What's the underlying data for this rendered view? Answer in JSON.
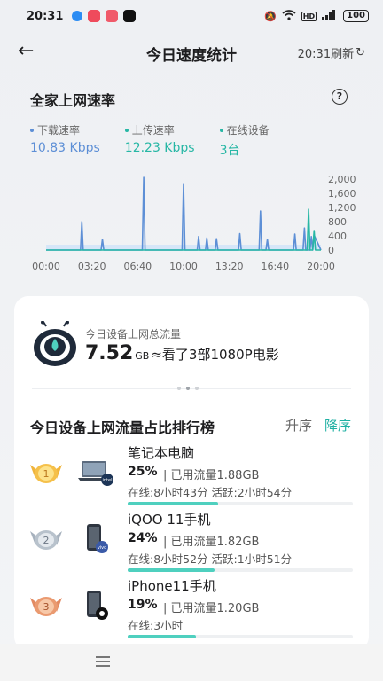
{
  "status_bar": {
    "time": "20:31",
    "battery": "100"
  },
  "nav": {
    "back": "←",
    "title": "今日速度统计",
    "refresh_label": "20:31刷新",
    "refresh_icon": "↻"
  },
  "speed": {
    "title": "全家上网速率",
    "help": "?",
    "legend": [
      {
        "label": "下载速率",
        "value": "10.83 Kbps",
        "color": "#5d8fd6"
      },
      {
        "label": "上传速率",
        "value": "12.23 Kbps",
        "color": "#27b7a5"
      },
      {
        "label": "在线设备",
        "value": "3台",
        "color": "#27b7a5"
      }
    ]
  },
  "chart_data": {
    "type": "line",
    "x_ticks": [
      "00:00",
      "03:20",
      "06:40",
      "10:00",
      "13:20",
      "16:40",
      "20:00"
    ],
    "y_ticks": [
      "2,000",
      "1,600",
      "1,200",
      "800",
      "400",
      "0"
    ],
    "ylim": [
      0,
      2000
    ],
    "xlim_hours": [
      0,
      20
    ],
    "series": [
      {
        "color": "#5d8fd6",
        "x": [
          0,
          2.5,
          2.6,
          2.7,
          4.0,
          4.1,
          4.2,
          7.0,
          7.1,
          7.2,
          9.9,
          10.0,
          10.1,
          11.0,
          11.1,
          11.2,
          11.6,
          11.7,
          11.8,
          12.3,
          12.4,
          12.5,
          14.0,
          14.1,
          14.2,
          15.5,
          15.6,
          15.7,
          16.0,
          16.1,
          16.2,
          18.0,
          18.1,
          18.2,
          18.7,
          18.8,
          18.9,
          19.2,
          19.3,
          19.4,
          19.5,
          20.0
        ],
        "y": [
          0,
          0,
          800,
          0,
          0,
          300,
          0,
          0,
          2050,
          0,
          0,
          1870,
          0,
          0,
          380,
          0,
          0,
          340,
          0,
          0,
          320,
          0,
          0,
          460,
          0,
          0,
          1100,
          0,
          0,
          300,
          0,
          0,
          450,
          0,
          0,
          620,
          0,
          0,
          380,
          0,
          420,
          0
        ]
      },
      {
        "color": "#27b7a5",
        "x": [
          0,
          19.0,
          19.1,
          19.2,
          19.4,
          19.5,
          19.6,
          20.0
        ],
        "y": [
          0,
          0,
          1150,
          0,
          0,
          550,
          0,
          0
        ]
      }
    ]
  },
  "summary": {
    "label": "今日设备上网总流量",
    "value": "7.52",
    "unit": "GB",
    "compare": "≈看了3部1080P电影"
  },
  "ranking": {
    "title": "今日设备上网流量占比排行榜",
    "sort_asc": "升序",
    "sort_desc": "降序",
    "rows": [
      {
        "rank": "1",
        "name": "笔记本电脑",
        "pct": "25%",
        "used": "| 已用流量1.88GB",
        "online": "在线:8小时43分 活跃:2小时54分",
        "fill": 0.25,
        "medal": "#f0b43c",
        "device": "laptop"
      },
      {
        "rank": "2",
        "name": "iQOO 11手机",
        "pct": "24%",
        "used": "| 已用流量1.82GB",
        "online": "在线:8小时52分 活跃:1小时51分",
        "fill": 0.24,
        "medal": "#a6b1bd",
        "device": "phone"
      },
      {
        "rank": "3",
        "name": "iPhone11手机",
        "pct": "19%",
        "used": "| 已用流量1.20GB",
        "online": "在线:3小时",
        "fill": 0.19,
        "medal": "#e28a62",
        "device": "phone"
      }
    ]
  },
  "bottom": {
    "menu_icon": "menu-icon"
  }
}
